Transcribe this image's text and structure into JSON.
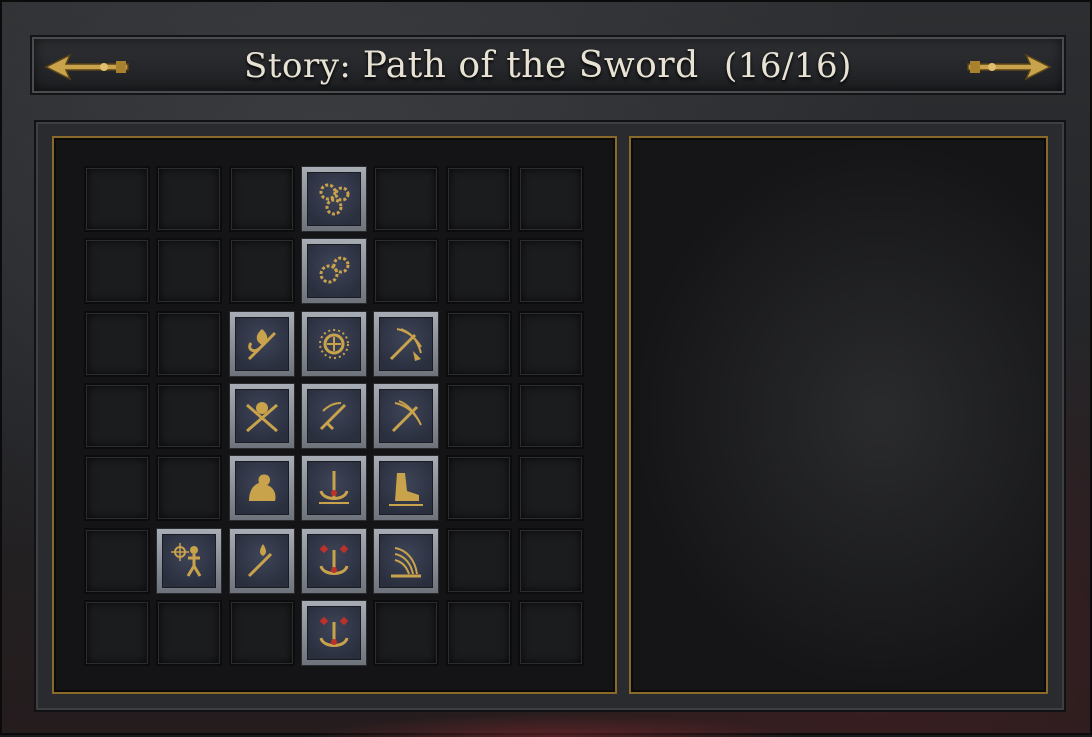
{
  "window": {
    "title_prefix": "Story:",
    "title_main": "Path of the Sword",
    "title_count": "(16/16)"
  },
  "colors": {
    "gold": "#c9a24c",
    "frame_gold": "#8a6a2a",
    "node_face": "#2f3546",
    "title_text": "#e8e2d4"
  },
  "grid": {
    "rows": 7,
    "cols": 7
  },
  "nodes": [
    {
      "row": 0,
      "col": 3,
      "icon": "gears-cluster-icon"
    },
    {
      "row": 1,
      "col": 3,
      "icon": "double-gear-icon"
    },
    {
      "row": 2,
      "col": 2,
      "icon": "fleur-de-lis-sword-icon"
    },
    {
      "row": 2,
      "col": 3,
      "icon": "sun-gear-icon"
    },
    {
      "row": 2,
      "col": 4,
      "icon": "sword-slash-gauntlet-icon"
    },
    {
      "row": 3,
      "col": 2,
      "icon": "skull-crossed-swords-icon"
    },
    {
      "row": 3,
      "col": 3,
      "icon": "sword-strike-icon"
    },
    {
      "row": 3,
      "col": 4,
      "icon": "sword-slash-icon"
    },
    {
      "row": 4,
      "col": 2,
      "icon": "flexed-arm-icon"
    },
    {
      "row": 4,
      "col": 3,
      "icon": "sword-anchor-icon"
    },
    {
      "row": 4,
      "col": 4,
      "icon": "boot-stride-icon"
    },
    {
      "row": 5,
      "col": 1,
      "icon": "figure-sunburst-icon"
    },
    {
      "row": 5,
      "col": 2,
      "icon": "sword-drop-icon"
    },
    {
      "row": 5,
      "col": 3,
      "icon": "anchor-red-gems-icon"
    },
    {
      "row": 5,
      "col": 4,
      "icon": "sweeping-arc-icon"
    },
    {
      "row": 6,
      "col": 3,
      "icon": "anchor-red-gems-icon"
    }
  ]
}
